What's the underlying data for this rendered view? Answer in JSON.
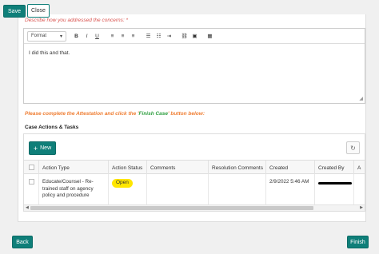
{
  "header": {
    "save_label": "Save",
    "close_label": "Close"
  },
  "editor": {
    "prompt": "Describe how you addressed the concerns: *",
    "format_label": "Format",
    "content": "I did this and that."
  },
  "attestation": {
    "prefix": "Please complete the Attestation and click the '",
    "highlight": "Finish Case",
    "suffix": "' button below:"
  },
  "section": {
    "title": "Case Actions & Tasks"
  },
  "grid": {
    "new_label": "New",
    "columns": [
      "Action Type",
      "Action Status",
      "Comments",
      "Resolution Comments",
      "Created",
      "Created By",
      "A"
    ],
    "rows": [
      {
        "action_type": "Educate/Counsel - Re-trained staff on agency policy and procedure",
        "action_status": "Open",
        "comments": "",
        "resolution_comments": "",
        "created": "2/9/2022 5:46 AM",
        "created_by": "",
        "a": ""
      }
    ]
  },
  "footer": {
    "back_label": "Back",
    "finish_label": "Finish"
  },
  "colors": {
    "accent": "#0f7f79",
    "required_red": "#d9534f",
    "orange": "#ef7d32",
    "green": "#2e9e3f",
    "badge_yellow": "#ffe600"
  }
}
